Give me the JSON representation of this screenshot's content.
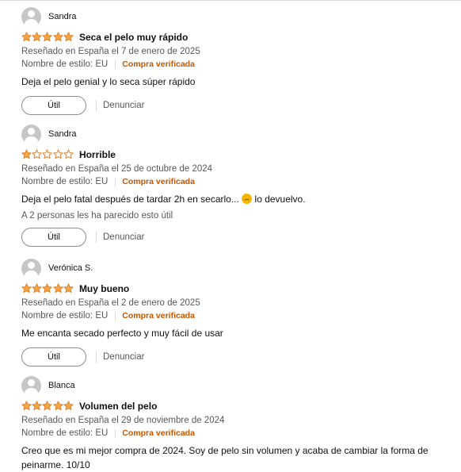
{
  "reviews": [
    {
      "author": "Sandra",
      "rating": 5,
      "title": "Seca el pelo muy rápido",
      "date": "Reseñado en España el 7 de enero de 2025",
      "style": "Nombre de estilo: EU",
      "verified": "Compra verificada",
      "body": "Deja el pelo genial y lo seca súper rápido",
      "helpful_button": "Útil",
      "report": "Denunciar"
    },
    {
      "author": "Sandra",
      "rating": 1,
      "title": "Horrible",
      "date": "Reseñado en España el 25 de octubre de 2024",
      "style": "Nombre de estilo: EU",
      "verified": "Compra verificada",
      "body_before": "Deja el pelo fatal después de tardar 2h en secarlo... ",
      "body_after": " lo devuelvo.",
      "helpful_count": "A 2 personas les ha parecido esto útil",
      "helpful_button": "Útil",
      "report": "Denunciar"
    },
    {
      "author": "Verónica S.",
      "rating": 5,
      "title": "Muy bueno",
      "date": "Reseñado en España el 2 de enero de 2025",
      "style": "Nombre de estilo: EU",
      "verified": "Compra verificada",
      "body": "Me encanta secado perfecto y muy fácil de usar",
      "helpful_button": "Útil",
      "report": "Denunciar"
    },
    {
      "author": "Blanca",
      "rating": 5,
      "title": "Volumen del pelo",
      "date": "Reseñado en España el 29 de noviembre de 2024",
      "style": "Nombre de estilo: EU",
      "verified": "Compra verificada",
      "body": "Creo que es mi mejor compra de 2024. Soy de pelo sin volumen y acaba de cambiar la forma de peinarme. 10/10"
    }
  ],
  "colors": {
    "star_fill": "#f3a847",
    "star_stroke": "#de7921",
    "verified": "#c45500",
    "meta_text": "#565959"
  },
  "icons": {
    "avatar": "avatar-icon",
    "star": "star-icon",
    "emoji": "confused-face-emoji"
  }
}
